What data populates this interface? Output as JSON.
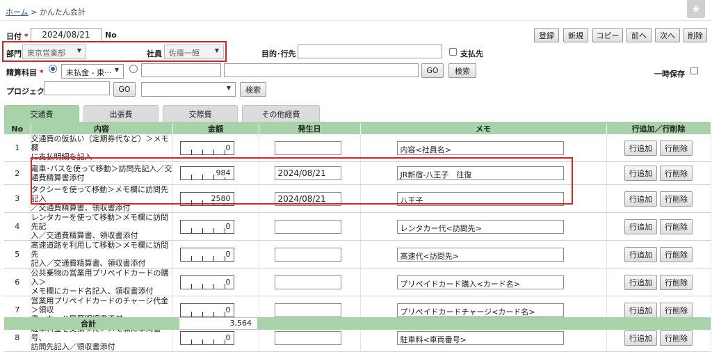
{
  "breadcrumb": {
    "home": "ホーム",
    "sep": ">",
    "current": "かんたん会計"
  },
  "header": {
    "date_label": "日付",
    "required_mark": "*",
    "date_value": "2024/08/21",
    "no_label": "No",
    "dept_label": "部門",
    "dept_value": "東京営業部",
    "employee_label": "社員",
    "employee_value": "佐藤一輝",
    "purpose_label": "目的･行先",
    "purpose_value": "",
    "payee_label": "支払先",
    "account_label": "精算科目",
    "account_select": "未払金 - 東···",
    "project_label": "プロジェクト",
    "temp_save_label": "一時保存",
    "go_label": "GO",
    "search_label": "検索"
  },
  "toolbar": {
    "register": "登録",
    "new": "新規",
    "copy": "コピー",
    "prev": "前へ",
    "next": "次へ",
    "delete": "削除"
  },
  "tabs": [
    "交通費",
    "出張費",
    "交際費",
    "その他経費"
  ],
  "table": {
    "headers": [
      "No",
      "内容",
      "金額",
      "発生日",
      "メモ",
      "行追加／行削除"
    ],
    "add_label": "行追加",
    "del_label": "行削除",
    "rows": [
      {
        "no": "1",
        "desc": [
          "交通費の仮払い（定期券代など）＞メモ欄",
          "に支払明細を記入"
        ],
        "amount": "0",
        "date": "",
        "memo": "内容<社員名>"
      },
      {
        "no": "2",
        "desc": [
          "電車･バスを使って移動＞訪問先記入／交",
          "通費精算書添付"
        ],
        "amount": "984",
        "date": "2024/08/21",
        "memo": "JR新宿-八王子　往復"
      },
      {
        "no": "3",
        "desc": [
          "タクシーを使って移動＞メモ欄に訪問先記入",
          "／交通費精算書、領収書添付"
        ],
        "amount": "2580",
        "date": "2024/08/21",
        "memo": "八王子"
      },
      {
        "no": "4",
        "desc": [
          "レンタカーを使って移動＞メモ欄に訪問先記",
          "入／交通費精算書、領収書添付"
        ],
        "amount": "0",
        "date": "",
        "memo": "レンタカー代<訪問先>"
      },
      {
        "no": "5",
        "desc": [
          "高速道路を利用して移動＞メモ欄に訪問先",
          "記入／交通費精算書、領収書添付"
        ],
        "amount": "0",
        "date": "",
        "memo": "高速代<訪問先>"
      },
      {
        "no": "6",
        "desc": [
          "公共乗物の営業用プリペイドカードの購入＞",
          "メモ欄にカード名記入、領収書添付"
        ],
        "amount": "0",
        "date": "",
        "memo": "プリペイドカード購入<カード名>"
      },
      {
        "no": "7",
        "desc": [
          "営業用プリペイドカードのチャージ代金＞領収",
          "書、カード履歴明細書添付"
        ],
        "amount": "0",
        "date": "",
        "memo": "プリペイドカードチャージ<カード名>"
      },
      {
        "no": "8",
        "desc": [
          "駐車料金を支払った＞メモ欄に車両番号、",
          "訪問先記入／領収書添付"
        ],
        "amount": "0",
        "date": "",
        "memo": "駐車料<車両番号>"
      }
    ],
    "total_label": "合計",
    "total_value": "3,564"
  },
  "colors": {
    "accent_green": "#a8d3a8",
    "highlight_red": "#e02020",
    "required_red": "#dd0000"
  }
}
